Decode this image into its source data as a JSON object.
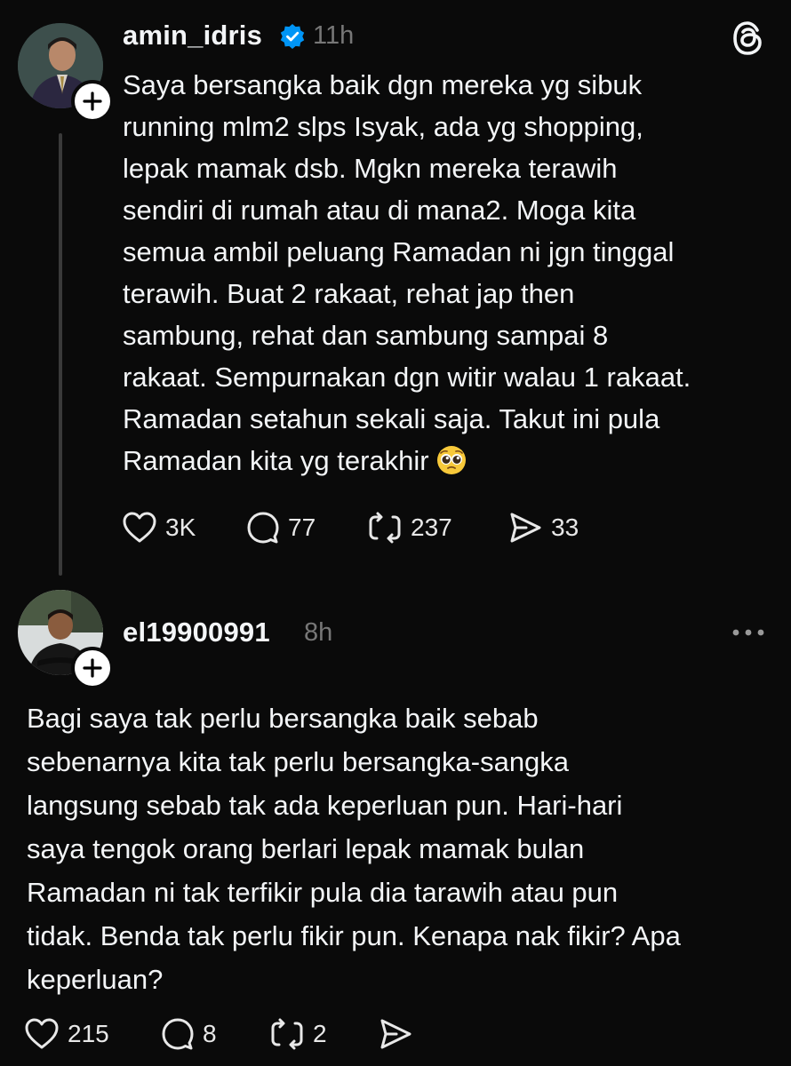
{
  "post": {
    "username": "amin_idris",
    "verified": true,
    "time": "11h",
    "text": "Saya bersangka baik dgn mereka yg sibuk\nrunning mlm2 slps Isyak, ada yg shopping,\nlepak mamak dsb. Mgkn mereka terawih\nsendiri di rumah atau di mana2. Moga kita\nsemua ambil peluang Ramadan ni jgn tinggal\nterawih. Buat 2 rakaat, rehat jap then\nsambung, rehat dan sambung sampai 8\nrakaat. Sempurnakan dgn witir walau 1 rakaat.\nRamadan setahun sekali saja. Takut ini pula\nRamadan kita yg terakhir",
    "emoji": "pleading-face",
    "likes": "3K",
    "replies": "77",
    "reposts": "237",
    "shares": "33"
  },
  "reply": {
    "username": "el19900991",
    "time": "8h",
    "text": "Bagi saya tak perlu bersangka baik sebab\nsebenarnya kita tak perlu bersangka-sangka\nlangsung sebab tak ada keperluan pun. Hari-hari\nsaya tengok orang berlari lepak mamak bulan\nRamadan ni tak terfikir pula dia tarawih atau pun\ntidak. Benda tak perlu fikir pun. Kenapa nak fikir? Apa\nkeperluan?",
    "likes": "215",
    "replies": "8",
    "reposts": "2"
  },
  "icons": {
    "app": "threads-logo-icon",
    "verified": "verified-badge-icon",
    "like": "heart-icon",
    "reply": "comment-icon",
    "repost": "repost-icon",
    "share": "share-icon",
    "more": "more-options-icon",
    "follow": "plus-icon"
  },
  "colors": {
    "background": "#0a0a0a",
    "verified": "#0095f6",
    "muted": "#777777"
  }
}
